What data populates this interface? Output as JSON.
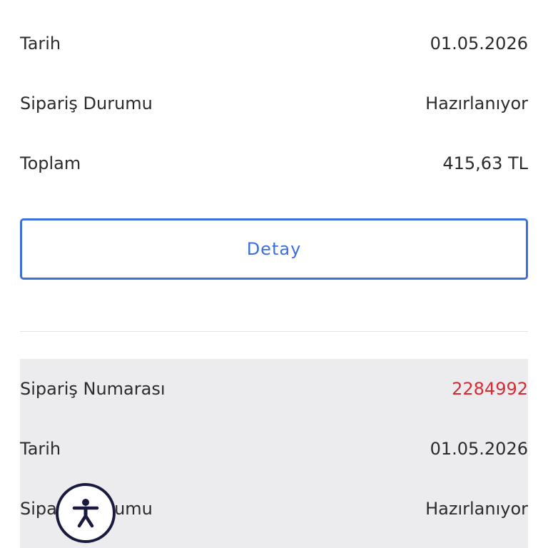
{
  "order1": {
    "date_label": "Tarih",
    "date_value": "01.05.2026",
    "status_label": "Sipariş Durumu",
    "status_value": "Hazırlanıyor",
    "total_label": "Toplam",
    "total_value": "415,63 TL",
    "detail_button": "Detay"
  },
  "order2": {
    "number_label": "Sipariş Numarası",
    "number_value": "2284992",
    "date_label": "Tarih",
    "date_value": "01.05.2026",
    "status_label": "Sipariş Durumu",
    "status_value": "Hazırlanıyor"
  },
  "accessibility": {
    "icon": "accessibility-icon"
  },
  "colors": {
    "accent": "#3b6fdc",
    "order_number": "#d62b35",
    "card_background": "#ececee",
    "accessibility_ring": "#1a1a3f"
  }
}
